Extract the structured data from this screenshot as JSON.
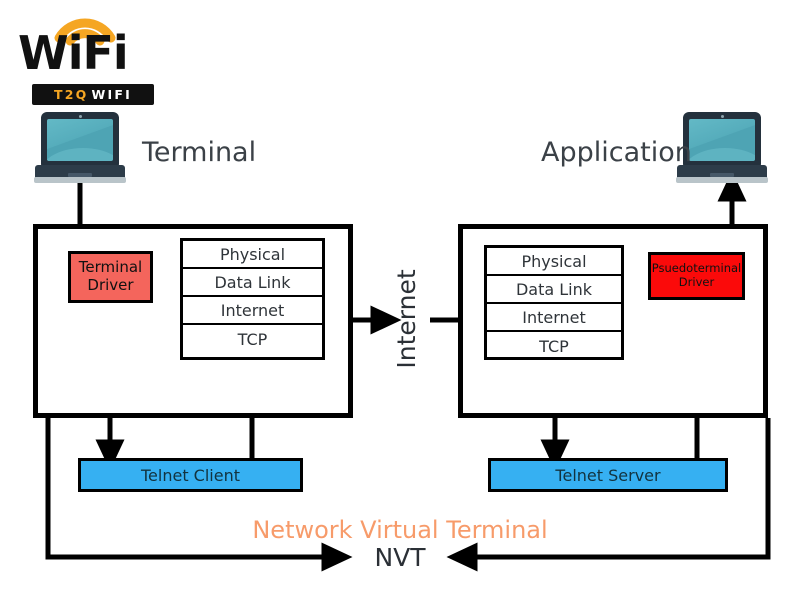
{
  "logo": {
    "wordmark": "WiFi",
    "badge_accent": "T2Q",
    "badge_name": "WIFI",
    "accent_color": "#f5a623",
    "bar_color": "#111111"
  },
  "endpoints": {
    "left": {
      "label": "Terminal",
      "icon": "laptop-icon"
    },
    "right": {
      "label": "Application",
      "icon": "laptop-icon"
    }
  },
  "left_host": {
    "driver": {
      "line1": "Terminal",
      "line2": "Driver",
      "color": "#f4655c"
    },
    "stack": {
      "layers": [
        "Physical",
        "Data Link",
        "Internet",
        "TCP"
      ]
    }
  },
  "right_host": {
    "driver": {
      "line1": "Psuedoterminal",
      "line2": "Driver",
      "color": "#fb0a0a"
    },
    "stack": {
      "layers": [
        "Physical",
        "Data Link",
        "Internet",
        "TCP"
      ]
    }
  },
  "telnet": {
    "client": {
      "label": "Telnet Client",
      "color": "#36b0f2"
    },
    "server": {
      "label": "Telnet Server",
      "color": "#36b0f2"
    }
  },
  "network": {
    "label": "Internet"
  },
  "nvt": {
    "title": "Network Virtual Terminal",
    "abbrev": "NVT",
    "title_color": "#f79b6a"
  }
}
